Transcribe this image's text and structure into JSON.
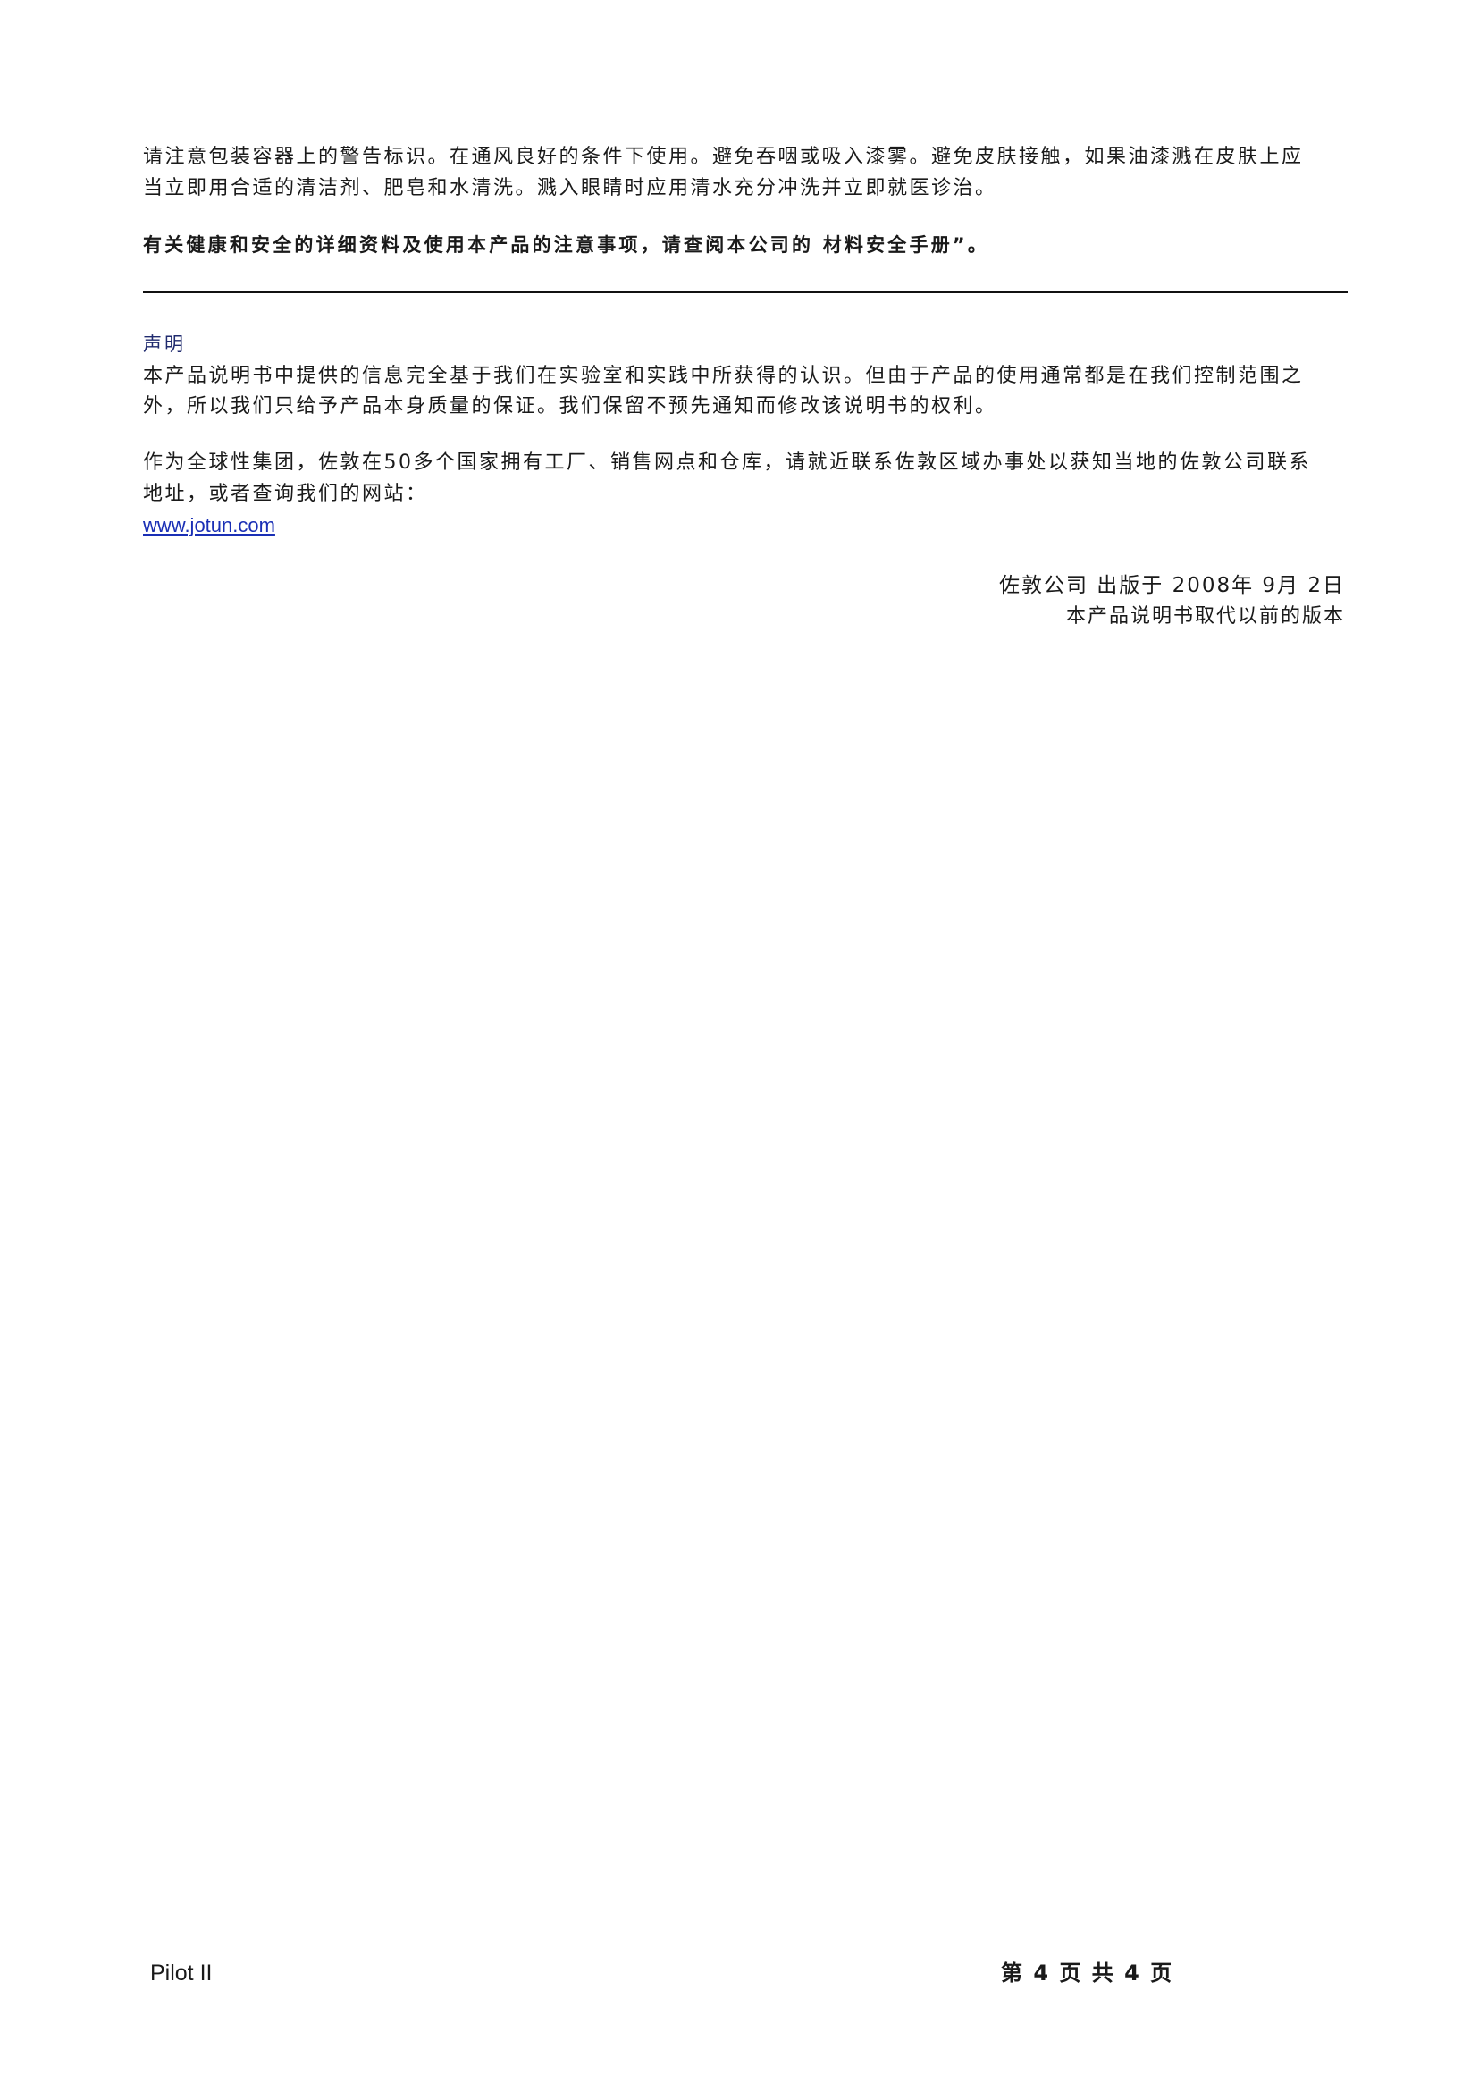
{
  "warning": {
    "line1": "请注意包装容器上的警告标识。在通风良好的条件下使用。避免吞咽或吸入漆雾。避免皮肤接触，如果油漆溅在皮肤上应",
    "line2": "当立即用合适的清洁剂、肥皂和水清洗。溅入眼睛时应用清水充分冲洗并立即就医诊治。"
  },
  "safety_note": "有关健康和安全的详细资料及使用本产品的注意事项，请查阅本公司的 材料安全手册”。",
  "declaration": {
    "heading": "声明",
    "line1": "本产品说明书中提供的信息完全基于我们在实验室和实践中所获得的认识。但由于产品的使用通常都是在我们控制范围之",
    "line2": "外，所以我们只给予产品本身质量的保证。我们保留不预先通知而修改该说明书的权利。"
  },
  "group_info": {
    "line1": "作为全球性集团，佐敦在50多个国家拥有工厂、销售网点和仓库，请就近联系佐敦区域办事处以获知当地的佐敦公司联系",
    "line2": "地址，或者查询我们的网站：",
    "website": "www.jotun.com"
  },
  "publication": {
    "line1": "佐敦公司 出版于 2008年 9月 2日",
    "line2": "本产品说明书取代以前的版本"
  },
  "footer": {
    "product": "Pilot II",
    "page_indicator": "第 4 页 共 4 页"
  }
}
